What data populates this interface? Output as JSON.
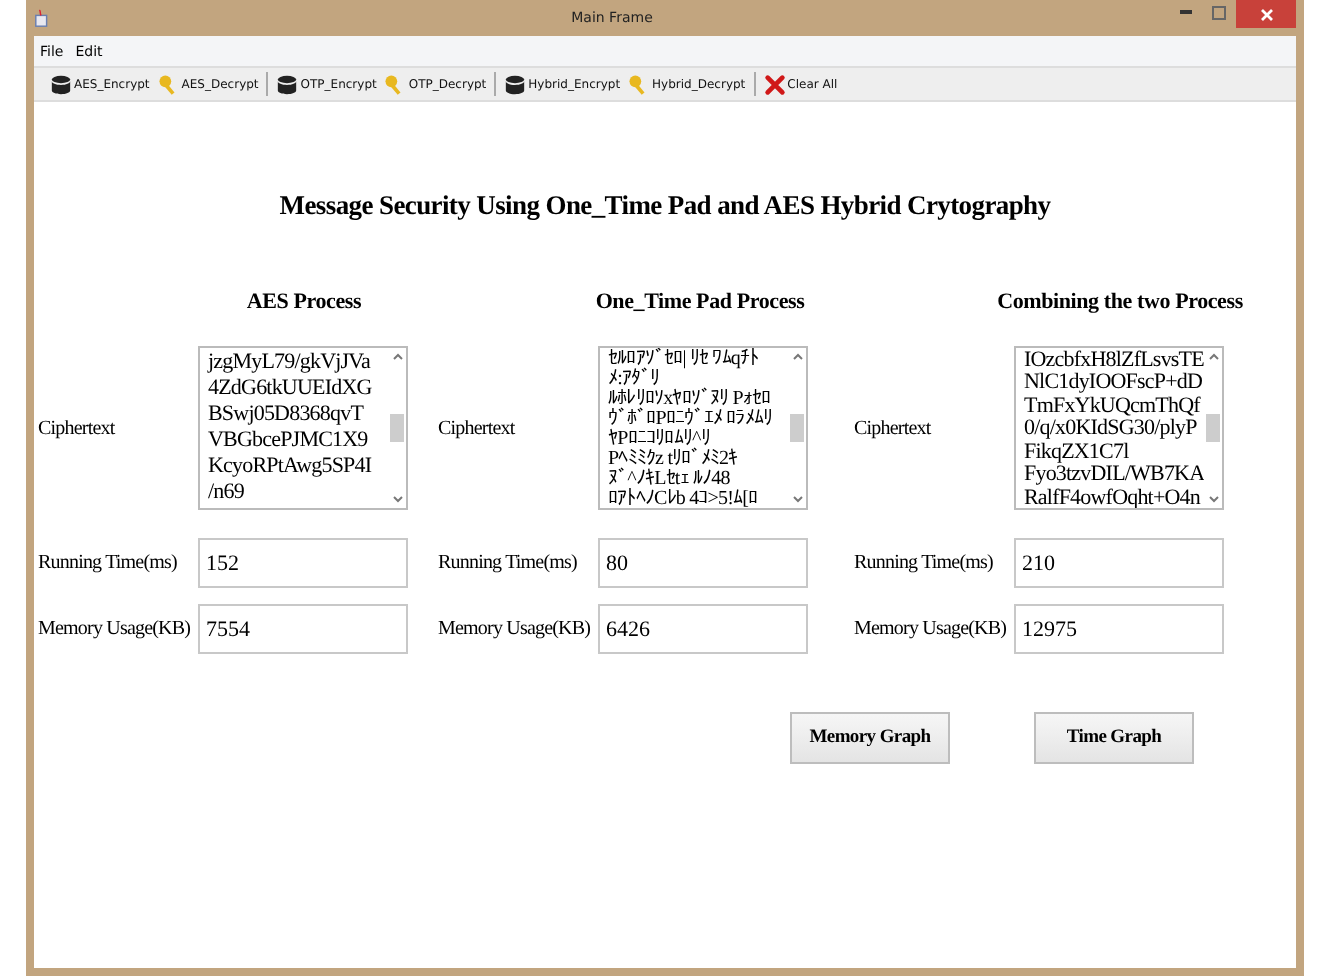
{
  "window": {
    "title": "Main Frame"
  },
  "menu": [
    "File",
    "Edit"
  ],
  "toolbar": [
    {
      "label": "AES_Encrypt",
      "kind": "encrypt",
      "separator_after": false
    },
    {
      "label": "AES_Decrypt",
      "kind": "decrypt",
      "separator_after": true
    },
    {
      "label": "OTP_Encrypt",
      "kind": "encrypt",
      "separator_after": false
    },
    {
      "label": "OTP_Decrypt",
      "kind": "decrypt",
      "separator_after": true
    },
    {
      "label": "Hybrid_Encrypt",
      "kind": "encrypt",
      "separator_after": false
    },
    {
      "label": "Hybrid_Decrypt",
      "kind": "decrypt",
      "separator_after": true
    },
    {
      "label": "Clear All",
      "kind": "clear",
      "separator_after": false
    }
  ],
  "heading": "Message Security Using One_Time Pad and AES Hybrid Crytography",
  "sections": [
    {
      "title": "AES Process",
      "ciphertext_label": "Ciphertext",
      "ciphertext_lines": [
        "jzgMyL79/gkVjJVa",
        "4ZdG6tkUUEIdXG",
        "BSwj05D8368qvT",
        "VBGbcePJMC1X9",
        "KcyoRPtAwg5SP4I",
        "/n69"
      ],
      "running_time_label": "Running Time(ms)",
      "running_time": "152",
      "memory_label": "Memory Usage(KB)",
      "memory": "7554"
    },
    {
      "title": "One_Time Pad Process",
      "ciphertext_label": "Ciphertext",
      "ciphertext_lines": [
        "ｾﾙﾛｱｿﾞｾﾛ| ﾘｾ ﾜﾑqﾁﾄ",
        "ﾒ:ｱﾀﾞﾘ",
        "ﾙﾎﾚﾘﾛｿxﾔﾛｿﾞﾇﾘ Pｫｾﾛ",
        "ｳﾞﾎﾞﾛPﾛﾆｳﾞｴﾒ ﾛﾗﾒﾑﾘ",
        "ﾔPﾛﾆｺﾘﾛﾑﾘ^ﾘ",
        "Pﾍﾐﾐｸz tﾘﾛﾞﾒﾐ2ｷ",
        "ﾇﾞ^ﾉｷLｾtｪ ﾙﾉ48",
        "ﾛｱﾄﾍﾉCﾚb 4ｺ>5!ﾑ[ﾛ"
      ],
      "running_time_label": "Running Time(ms)",
      "running_time": "80",
      "memory_label": "Memory Usage(KB)",
      "memory": "6426"
    },
    {
      "title": "Combining the two Process",
      "ciphertext_label": "Ciphertext",
      "ciphertext_lines": [
        "IOzcbfxH8lZfLsvsTE",
        "NlC1dyIOOFscP+dD",
        "TmFxYkUQcmThQf",
        "0/q/x0KIdSG30/plyP",
        "FikqZX1C7l",
        "Fyo3tzvDIL/WB7KA",
        "RalfF4owfOqht+O4n"
      ],
      "running_time_label": "Running Time(ms)",
      "running_time": "210",
      "memory_label": "Memory Usage(KB)",
      "memory": "12975"
    }
  ],
  "buttons": [
    "Memory Graph",
    "Time Graph"
  ]
}
